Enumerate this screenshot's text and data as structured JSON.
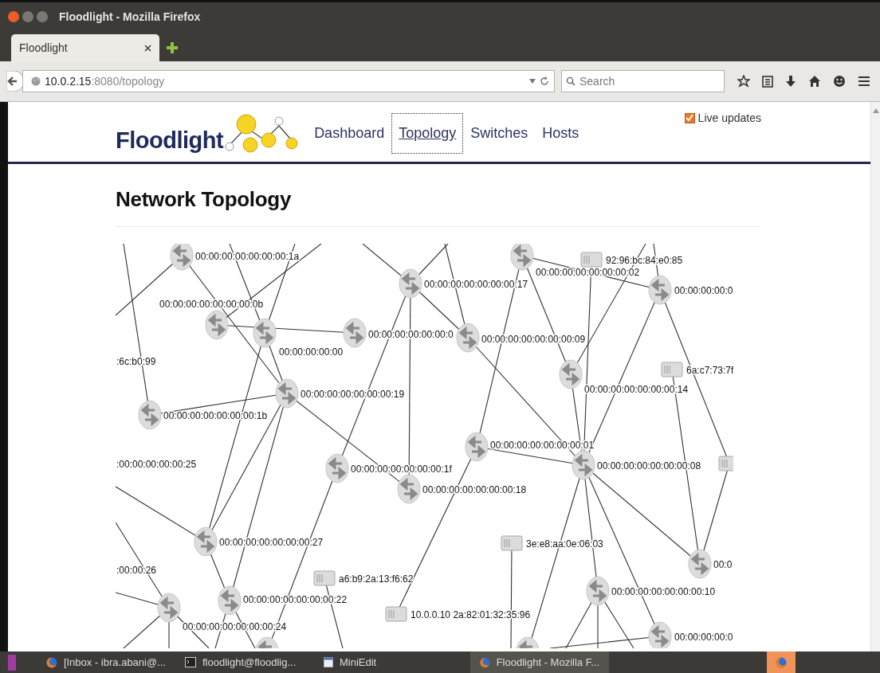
{
  "window": {
    "title": "Floodlight - Mozilla Firefox"
  },
  "tabs": [
    {
      "label": "Floodlight",
      "selected": true
    }
  ],
  "address_bar": {
    "host": "10.0.2.15",
    "path": ":8080/topology"
  },
  "search": {
    "placeholder": "Search"
  },
  "site": {
    "brand": "Floodlight",
    "nav": [
      {
        "label": "Dashboard",
        "selected": false
      },
      {
        "label": "Topology",
        "selected": true
      },
      {
        "label": "Switches",
        "selected": false
      },
      {
        "label": "Hosts",
        "selected": false
      }
    ],
    "live_updates": {
      "label": "Live updates",
      "checked": true
    }
  },
  "heading": "Network Topology",
  "topology": {
    "nodes": [
      {
        "kind": "switch",
        "label": "00:00:00:00:00:00:00:1a"
      },
      {
        "kind": "switch",
        "label": "00:00:00:00:00:00:00:0b"
      },
      {
        "kind": "switch",
        "label": "00:00:00:00:00"
      },
      {
        "kind": "switch",
        "label": "00:00:00:00:00:00:0"
      },
      {
        "kind": "switch",
        "label": "00:00:00:00:00:00:00:09"
      },
      {
        "kind": "switch",
        "label": "00:00:00:00:00:00:00:17"
      },
      {
        "kind": "switch",
        "label": "00:00:00:00:00:00:00:02"
      },
      {
        "kind": "switch",
        "label": "00:00:00:00:0"
      },
      {
        "kind": "switch",
        "label": "00:00:00:00:00:00:00:14"
      },
      {
        "kind": "switch",
        "label": "00:00:00:00:00:00:00:19"
      },
      {
        "kind": "switch",
        "label": "00:00:00:00:00:00:00:1b"
      },
      {
        "kind": "switch",
        "label": "00:00:00:00:00:00:00:01"
      },
      {
        "kind": "switch",
        "label": "00:00:00:00:00:00:00:08"
      },
      {
        "kind": "switch",
        "label": "00:00:00:00:00:00:00:1f"
      },
      {
        "kind": "switch",
        "label": "00:00:00:00:00:00:00:18"
      },
      {
        "kind": "switch",
        "label": "00:00:00:00:00:00:00:27"
      },
      {
        "kind": "switch",
        "label": "00:0"
      },
      {
        "kind": "switch",
        "label": "00:00:00:00:00:00:00:10"
      },
      {
        "kind": "switch",
        "label": "00:00:00:00:00:00:00:24"
      },
      {
        "kind": "switch",
        "label": "00:00:00:00:00:00:00:22"
      },
      {
        "kind": "switch",
        "label": "00:00:00:00:0"
      },
      {
        "kind": "switch"
      },
      {
        "kind": "switch"
      },
      {
        "kind": "host",
        "label": "92:96:bc:84:e0:85"
      },
      {
        "kind": "host",
        "label": "6a:c7:73:7f"
      },
      {
        "kind": "host"
      },
      {
        "kind": "host",
        "label": "3e:e8:aa:0e:06:03"
      },
      {
        "kind": "host",
        "label": "a6:b9:2a:13:f6:62"
      },
      {
        "kind": "host",
        "label": "10.0.0.10 2a:82:01:32:35:96"
      },
      {
        "kind": "label",
        "label": ":6c:b0:99"
      },
      {
        "kind": "label",
        "label": ":00:00:00:00:00:25"
      },
      {
        "kind": "label",
        "label": ":00:00:26"
      }
    ]
  },
  "taskbar": [
    {
      "label": "[Inbox - ibra.abani@...",
      "selected": false
    },
    {
      "label": "floodlight@floodlig...",
      "selected": false
    },
    {
      "label": "MiniEdit",
      "selected": false
    },
    {
      "label": "Floodlight - Mozilla F...",
      "selected": true
    }
  ]
}
